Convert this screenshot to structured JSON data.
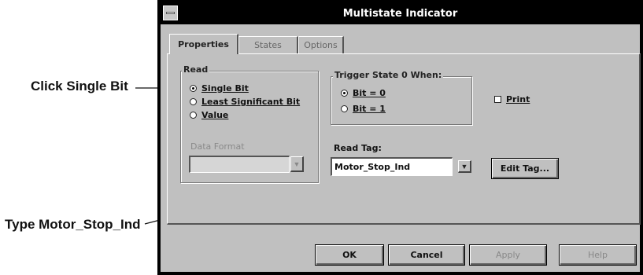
{
  "callouts": {
    "click_single_bit": "Click Single Bit",
    "type_tag": "Type Motor_Stop_Ind"
  },
  "window": {
    "title": "Multistate Indicator"
  },
  "tabs": [
    {
      "label": "Properties",
      "active": true
    },
    {
      "label": "States",
      "active": false
    },
    {
      "label": "Options",
      "active": false
    }
  ],
  "read_group": {
    "title": "Read",
    "options": [
      {
        "label": "Single Bit",
        "selected": true
      },
      {
        "label": "Least Significant Bit",
        "selected": false
      },
      {
        "label": "Value",
        "selected": false
      }
    ],
    "data_format_label": "Data Format",
    "data_format_value": ""
  },
  "trigger_group": {
    "title": "Trigger State 0 When:",
    "options": [
      {
        "label": "Bit = 0",
        "selected": true
      },
      {
        "label": "Bit = 1",
        "selected": false
      }
    ]
  },
  "print": {
    "label": "Print",
    "checked": false
  },
  "read_tag": {
    "label": "Read Tag:",
    "value": "Motor_Stop_Ind",
    "edit_button": "Edit Tag..."
  },
  "buttons": {
    "ok": "OK",
    "cancel": "Cancel",
    "apply": "Apply",
    "help": "Help"
  }
}
